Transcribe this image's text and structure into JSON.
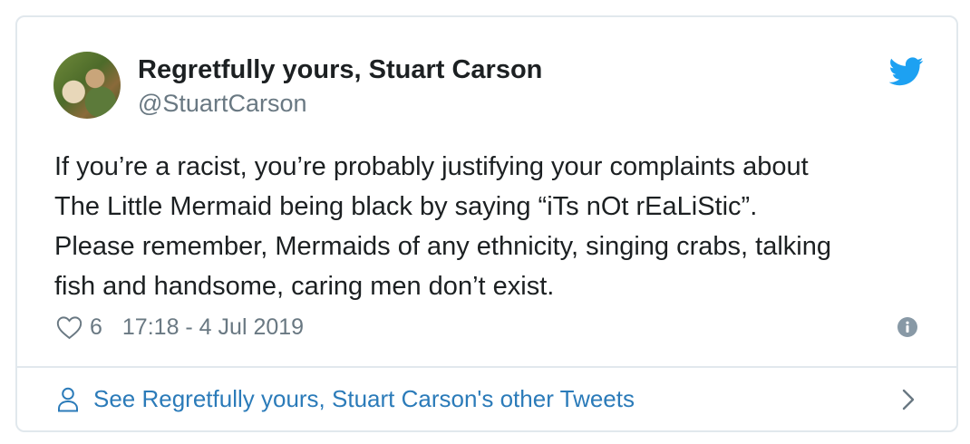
{
  "author": {
    "display_name": "Regretfully yours, Stuart Carson",
    "handle": "@StuartCarson",
    "avatar_icon": "profile-photo"
  },
  "brand": {
    "icon": "twitter-bird-icon",
    "color": "#1da1f2"
  },
  "tweet": {
    "lines": [
      "If you’re a racist, you’re probably justifying your complaints about",
      "The Little Mermaid being black by saying “iTs nOt rEaLiStic”.",
      "Please remember, Mermaids of any ethnicity, singing crabs, talking",
      "fish and handsome, caring men don’t exist."
    ]
  },
  "meta": {
    "likes": "6",
    "timestamp": "17:18 - 4 Jul 2019",
    "like_icon": "heart-icon",
    "info_icon": "info-icon"
  },
  "footer": {
    "label": "See Regretfully yours, Stuart Carson's other Tweets",
    "link_color": "#2b7bb9",
    "person_icon": "person-icon",
    "chevron_icon": "chevron-right-icon"
  }
}
